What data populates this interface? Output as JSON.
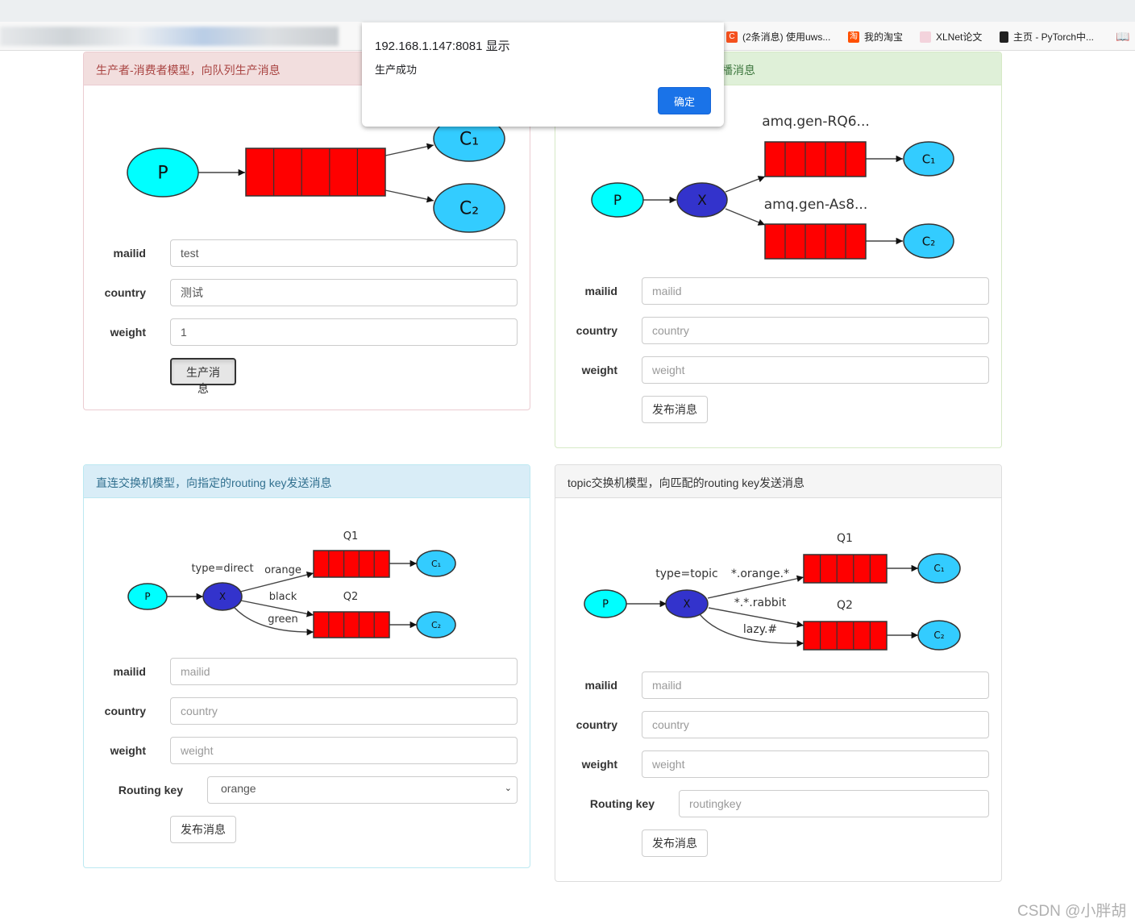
{
  "browser": {
    "bookmarks": [
      {
        "label": "(2条消息) 使用uws...",
        "icon": "csdn-icon",
        "color": "#f4511e",
        "glyph": "C"
      },
      {
        "label": "我的淘宝",
        "icon": "taobao-icon",
        "color": "#ff5000",
        "glyph": "淘"
      },
      {
        "label": "XLNet论文",
        "icon": "paper-icon",
        "color": "#e9a",
        "glyph": ""
      },
      {
        "label": "主页 - PyTorch中...",
        "icon": "book-icon",
        "color": "#222",
        "glyph": ""
      }
    ],
    "reading_list_icon": "reading-list-icon"
  },
  "dialog": {
    "title": "192.168.1.147:8081 显示",
    "message": "生产成功",
    "ok": "确定"
  },
  "panels": {
    "simple": {
      "title": "生产者-消费者模型，向队列生产消息",
      "fields": {
        "mailid": "mailid",
        "country": "country",
        "weight": "weight"
      },
      "values": {
        "mailid": "test",
        "country": "测试",
        "weight": "1"
      },
      "button": "生产消息",
      "diagram": {
        "P": "P",
        "C1": "C₁",
        "C2": "C₂"
      }
    },
    "fanout": {
      "title_visible": "播消息",
      "fields": {
        "mailid": "mailid",
        "country": "country",
        "weight": "weight"
      },
      "placeholders": {
        "mailid": "mailid",
        "country": "country",
        "weight": "weight"
      },
      "button": "发布消息",
      "diagram": {
        "P": "P",
        "X": "X",
        "C1": "C₁",
        "C2": "C₂",
        "q1": "amq.gen-RQ6...",
        "q2": "amq.gen-As8..."
      }
    },
    "direct": {
      "title": "直连交换机模型，向指定的routing key发送消息",
      "fields": {
        "mailid": "mailid",
        "country": "country",
        "weight": "weight",
        "routing": "Routing key"
      },
      "placeholders": {
        "mailid": "mailid",
        "country": "country",
        "weight": "weight"
      },
      "routing_selected": "orange",
      "button": "发布消息",
      "diagram": {
        "P": "P",
        "X": "X",
        "C1": "C₁",
        "C2": "C₂",
        "q1": "Q1",
        "q2": "Q2",
        "type": "type=direct",
        "k1": "orange",
        "k2": "black",
        "k3": "green"
      }
    },
    "topic": {
      "title": "topic交换机模型，向匹配的routing key发送消息",
      "fields": {
        "mailid": "mailid",
        "country": "country",
        "weight": "weight",
        "routing": "Routing key"
      },
      "placeholders": {
        "mailid": "mailid",
        "country": "country",
        "weight": "weight",
        "routing": "routingkey"
      },
      "button": "发布消息",
      "diagram": {
        "P": "P",
        "X": "X",
        "C1": "C₁",
        "C2": "C₂",
        "q1": "Q1",
        "q2": "Q2",
        "type": "type=topic",
        "k1": "*.orange.*",
        "k2": "*.*.rabbit",
        "k3": "lazy.#"
      }
    }
  },
  "colors": {
    "producer": "#00ffff",
    "exchange": "#3333cc",
    "queue": "#ff0000",
    "consumer": "#33ccff",
    "primary": "#1a73e8"
  },
  "watermark": "CSDN @小胖胡"
}
